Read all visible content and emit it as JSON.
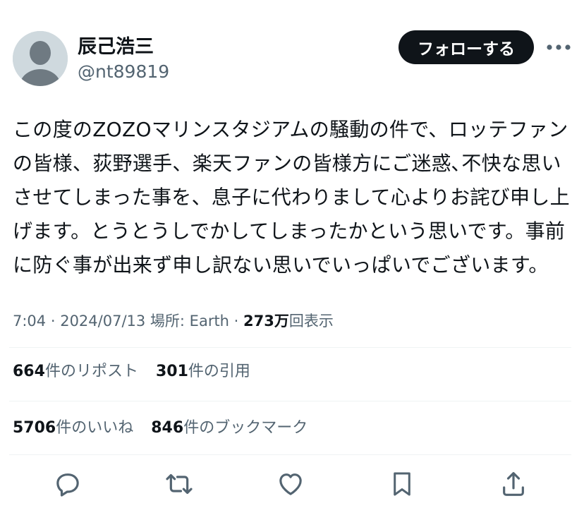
{
  "author": {
    "display_name": "辰己浩三",
    "handle": "@nt89819"
  },
  "follow_label": "フォローする",
  "more_icon": "more-horizontal-icon",
  "tweet_lines": [
    "この度のZOZOマリンスタジアムの騒動の件で、ロッテファン",
    "の皆様、荻野選手、楽天ファンの皆様方にご迷惑､不快な思い",
    "させてしまった事を、息子に代わりまして心よりお詫び申し上",
    "げます。とうとうしでかしてしまったかという思いです。事前",
    "に防ぐ事が出来ず申し訳ない思いでいっぱいでございます。"
  ],
  "meta": {
    "time": "7:04",
    "sep1": " · ",
    "date": "2024/07/13",
    "location": " 場所: Earth",
    "sep2": " · ",
    "views_count": "273万",
    "views_label": "回表示"
  },
  "stats": {
    "reposts": {
      "count": "664",
      "label": "件のリポスト"
    },
    "quotes": {
      "count": "301",
      "label": "件の引用"
    },
    "likes": {
      "count": "5706",
      "label": "件のいいね"
    },
    "bookmarks": {
      "count": "846",
      "label": "件のブックマーク"
    }
  },
  "actions": [
    {
      "name": "reply",
      "icon": "reply-icon"
    },
    {
      "name": "repost",
      "icon": "repost-icon"
    },
    {
      "name": "like",
      "icon": "heart-icon"
    },
    {
      "name": "bookmark",
      "icon": "bookmark-icon"
    },
    {
      "name": "share",
      "icon": "share-icon"
    }
  ],
  "colors": {
    "text_primary": "#0f1419",
    "text_secondary": "#536471",
    "divider": "#eff3f4",
    "follow_bg": "#0f1419",
    "avatar_bg": "#cfd9de",
    "avatar_fg": "#6f7a82"
  }
}
